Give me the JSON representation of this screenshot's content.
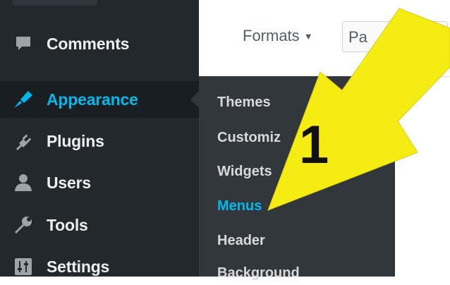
{
  "sidebar": {
    "items": [
      {
        "label": "Comments",
        "icon": "comment-icon",
        "active": false
      },
      {
        "label": "Appearance",
        "icon": "paintbrush-icon",
        "active": true
      },
      {
        "label": "Plugins",
        "icon": "plug-icon",
        "active": false
      },
      {
        "label": "Users",
        "icon": "user-icon",
        "active": false
      },
      {
        "label": "Tools",
        "icon": "wrench-icon",
        "active": false
      },
      {
        "label": "Settings",
        "icon": "settings-icon",
        "active": false
      }
    ]
  },
  "editor_toolbar": {
    "formats_label": "Formats",
    "formats_caret": "▼",
    "paragraph_label": "Pa"
  },
  "submenu": {
    "items": [
      "Themes",
      "Customiz",
      "Widgets",
      "Menus",
      "Header",
      "Background"
    ],
    "current": "Menus"
  },
  "annotation": {
    "number": "1",
    "arrow_color": "#f5ec14"
  },
  "colors": {
    "sidebar_bg": "#23282d",
    "submenu_bg": "#32373c",
    "accent": "#00b9eb"
  }
}
